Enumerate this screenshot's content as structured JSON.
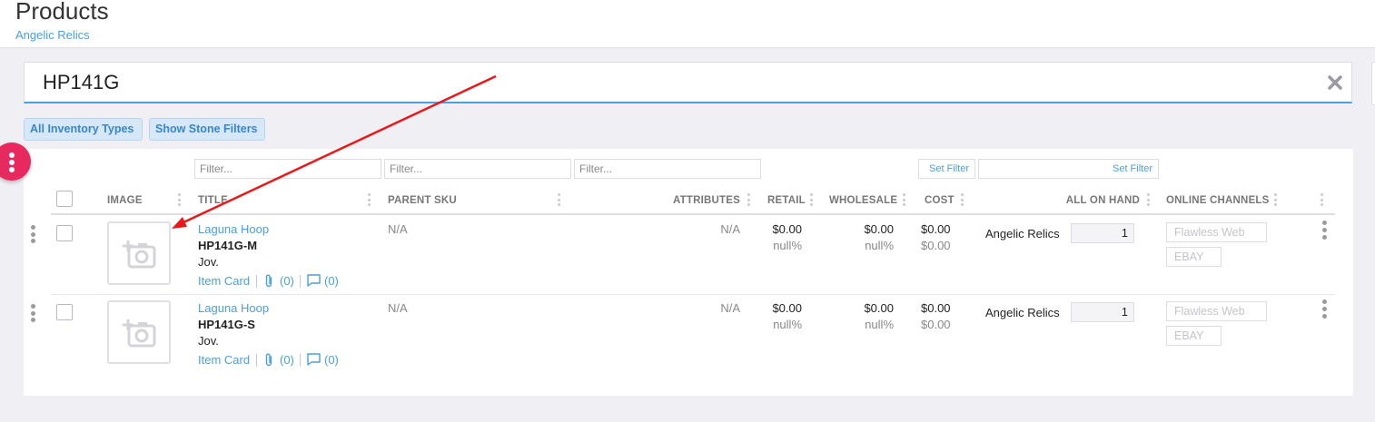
{
  "header": {
    "title": "Products",
    "subtitle": "Angelic Relics"
  },
  "search": {
    "value": "HP141G"
  },
  "filters": {
    "inventory_types_label": "All Inventory Types",
    "stone_filters_label": "Show Stone Filters"
  },
  "column_filters": {
    "placeholder": "Filter...",
    "set_filter_label": "Set Filter"
  },
  "table": {
    "columns": {
      "image": "IMAGE",
      "title": "TITLE",
      "parent_sku": "PARENT SKU",
      "attributes": "ATTRIBUTES",
      "retail": "RETAIL",
      "wholesale": "WHOLESALE",
      "cost": "COST",
      "all_on_hand": "ALL ON HAND",
      "online_channels": "ONLINE CHANNELS"
    },
    "rows": [
      {
        "title": "Laguna Hoop",
        "sku": "HP141G-M",
        "type": "Jov.",
        "item_card": "Item Card",
        "attachments": "(0)",
        "comments": "(0)",
        "parent_sku": "N/A",
        "attributes": "N/A",
        "retail": "$0.00",
        "retail_pct": "null%",
        "wholesale": "$0.00",
        "wholesale_pct": "null%",
        "cost": "$0.00",
        "cost_sub": "$0.00",
        "location": "Angelic Relics",
        "on_hand": "1",
        "channels": [
          "Flawless Web",
          "EBAY"
        ]
      },
      {
        "title": "Laguna Hoop",
        "sku": "HP141G-S",
        "type": "Jov.",
        "item_card": "Item Card",
        "attachments": "(0)",
        "comments": "(0)",
        "parent_sku": "N/A",
        "attributes": "N/A",
        "retail": "$0.00",
        "retail_pct": "null%",
        "wholesale": "$0.00",
        "wholesale_pct": "null%",
        "cost": "$0.00",
        "cost_sub": "$0.00",
        "location": "Angelic Relics",
        "on_hand": "1",
        "channels": [
          "Flawless Web",
          "EBAY"
        ]
      }
    ]
  },
  "colors": {
    "accent": "#4a9fe0",
    "fab": "#e8295f",
    "arrow": "#e8191b"
  },
  "icons": {
    "clear": "close-icon",
    "image_placeholder": "add-photo-icon",
    "attachment": "paperclip-icon",
    "comment": "comment-icon",
    "menu": "more-vertical-icon"
  }
}
